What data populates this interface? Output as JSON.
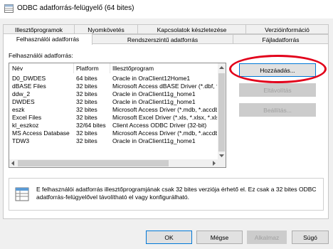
{
  "window": {
    "title": "ODBC adatforrás-felügyelő (64 bites)",
    "icon": "odbc-app-icon"
  },
  "tabs_back": [
    "Illesztőprogramok",
    "Nyomkövetés",
    "Kapcsolatok készletezése",
    "Verzióinformáció"
  ],
  "tabs_front": [
    "Felhasználói adatforrás",
    "Rendszerszintű adatforrás",
    "Fájladatforrás"
  ],
  "active_tab": "Felhasználói adatforrás",
  "list": {
    "caption": "Felhasználói adatforrás:",
    "columns": [
      "Név",
      "Platform",
      "Illesztőprogram"
    ],
    "rows": [
      [
        "D0_DWDES",
        "64 bites",
        "Oracle in OraClient12Home1"
      ],
      [
        "dBASE Files",
        "32 bites",
        "Microsoft Access dBASE Driver (*.dbf, *.n"
      ],
      [
        "ddw_2",
        "32 bites",
        "Oracle in OraClient11g_home1"
      ],
      [
        "DWDES",
        "32 bites",
        "Oracle in OraClient11g_home1"
      ],
      [
        "eszk",
        "32 bites",
        "Microsoft Access Driver (*.mdb, *.accdb)"
      ],
      [
        "Excel Files",
        "32 bites",
        "Microsoft Excel Driver (*.xls, *.xlsx, *.xlsm,"
      ],
      [
        "kl_eszkoz",
        "32/64 bites",
        "Client Access ODBC Driver (32-bit)"
      ],
      [
        "MS Access Database",
        "32 bites",
        "Microsoft Access Driver (*.mdb, *.accdb)"
      ],
      [
        "TDW3",
        "32 bites",
        "Oracle in OraClient11g_home1"
      ]
    ]
  },
  "side_buttons": {
    "add": "Hozzáadás...",
    "remove": "Eltávolítás",
    "configure": "Beállítás..."
  },
  "info_text": "E felhasználói adatforrás illesztőprogramjának csak 32 bites verziója érhető el. Ez csak a 32 bites ODBC adatforrás-felügyelővel távolítható el vagy konfigurálható.",
  "info_icon": "datasource-table-icon",
  "bottom_buttons": {
    "ok": "OK",
    "cancel": "Mégse",
    "apply": "Alkalmaz",
    "help": "Súgó"
  },
  "colors": {
    "highlight_ellipse": "#e2001a",
    "default_button_border": "#0078d7"
  }
}
